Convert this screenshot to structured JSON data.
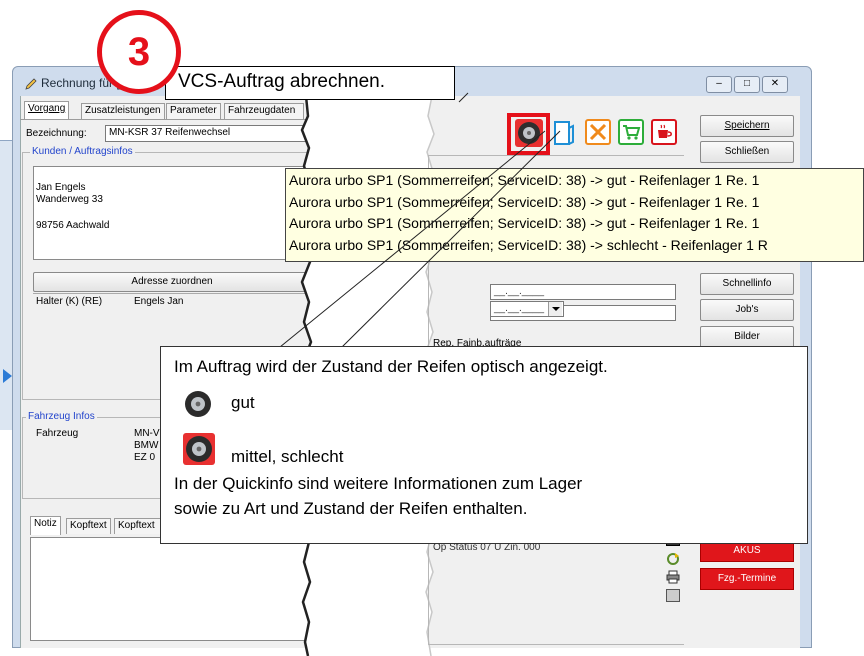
{
  "step": {
    "number": "3",
    "title": "VCS-Auftrag abrechnen."
  },
  "window": {
    "title": "Rechnung für [#]"
  },
  "tabs": [
    "Vorgang",
    "Zusatzleistungen",
    "Parameter",
    "Fahrzeugdaten"
  ],
  "bezeichnung": {
    "label": "Bezeichnung:",
    "value": "MN-KSR 37 Reifenwechsel"
  },
  "kunden": {
    "group_title": "Kunden / Auftragsinfos",
    "name": "Jan Engels",
    "street": "Wanderweg 33",
    "city": "98756 Aachwald",
    "assign_button": "Adresse zuordnen",
    "halter_label": "Halter (K) (RE)",
    "halter_value": "Engels Jan"
  },
  "fahrzeug": {
    "group_title": "Fahrzeug Infos",
    "label": "Fahrzeug",
    "line1": "MN-V",
    "line2": "BMW",
    "line3": "EZ 0"
  },
  "note_tabs": [
    "Notiz",
    "Kopftext",
    "Kopftext"
  ],
  "right_buttons": [
    "Speichern",
    "Schließen",
    "Schnellinfo",
    "Job's",
    "Bilder"
  ],
  "red_buttons": [
    "AKUS",
    "Fzg.-Termine"
  ],
  "date_placeholder": "__.__.____",
  "status_text": "Op Status 07 U Zin. 000",
  "partial_label": "Rep. Fainb.aufträge",
  "tooltip_lines": [
    "Aurora urbo SP1 (Sommerreifen; ServiceID: 38) -> gut - Reifenlager 1 Re. 1",
    "Aurora urbo SP1 (Sommerreifen; ServiceID: 38) -> gut - Reifenlager 1 Re. 1",
    "Aurora urbo SP1 (Sommerreifen; ServiceID: 38) -> gut - Reifenlager 1 Re. 1",
    "Aurora urbo SP1 (Sommerreifen; ServiceID: 38) -> schlecht - Reifenlager 1 R"
  ],
  "callout": {
    "heading": "Im Auftrag wird der Zustand der Reifen optisch angezeigt.",
    "good": "gut",
    "bad": "mittel, schlecht",
    "info_line1": "In der Quickinfo sind weitere Informationen zum Lager",
    "info_line2": "sowie zu Art und Zustand der Reifen enthalten."
  },
  "colors": {
    "accent_red": "#e5101a",
    "tooltip_bg": "#ffffe1",
    "group_blue": "#2244cc"
  }
}
